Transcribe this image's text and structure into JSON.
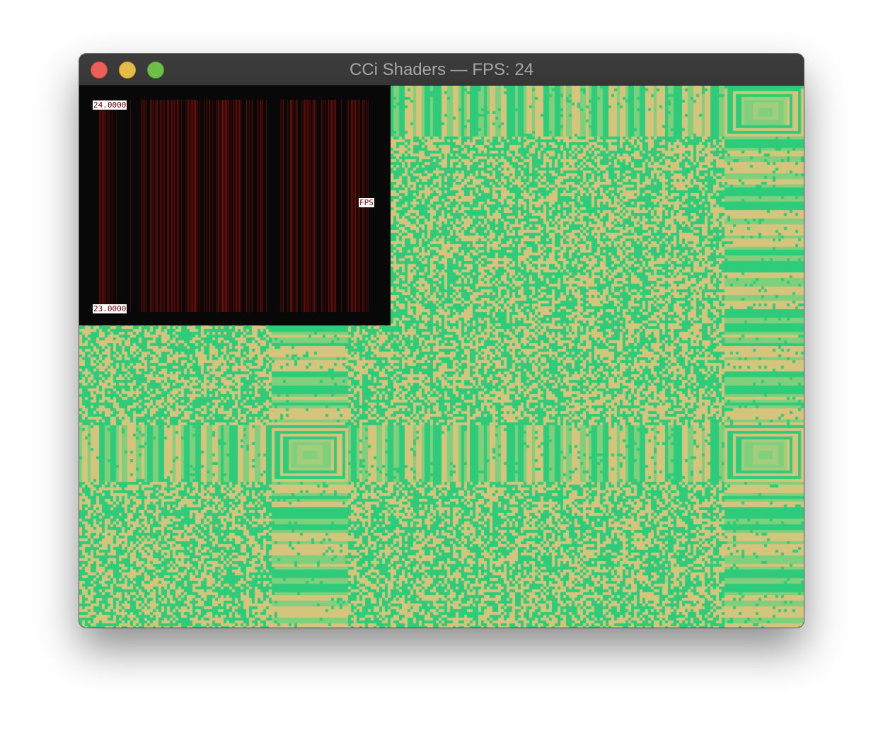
{
  "window": {
    "title": "CCi Shaders — FPS: 24"
  },
  "graph": {
    "max_label": "24.0000",
    "min_label": "23.0000",
    "series_label": "FPS",
    "bar_color": "#8a0c08",
    "background": "#080808"
  },
  "shader": {
    "colors": [
      "#2ecc7a",
      "#d4c47c",
      "#7fcf7d",
      "#a3cd7c"
    ]
  },
  "colors": {
    "close": "#ec5f57",
    "minimize": "#e3bd48",
    "zoom": "#6cc04a"
  }
}
